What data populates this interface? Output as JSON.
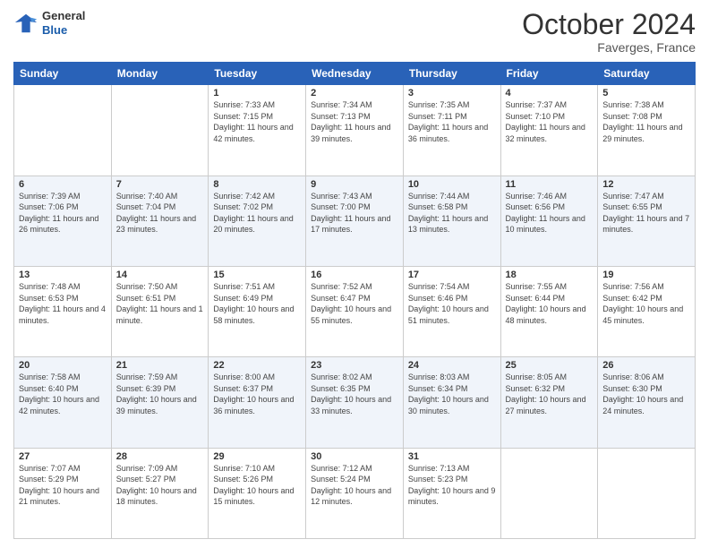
{
  "header": {
    "logo_line1": "General",
    "logo_line2": "Blue",
    "month": "October 2024",
    "location": "Faverges, France"
  },
  "weekdays": [
    "Sunday",
    "Monday",
    "Tuesday",
    "Wednesday",
    "Thursday",
    "Friday",
    "Saturday"
  ],
  "weeks": [
    [
      {
        "day": null,
        "info": null
      },
      {
        "day": null,
        "info": null
      },
      {
        "day": "1",
        "info": "Sunrise: 7:33 AM\nSunset: 7:15 PM\nDaylight: 11 hours and 42 minutes."
      },
      {
        "day": "2",
        "info": "Sunrise: 7:34 AM\nSunset: 7:13 PM\nDaylight: 11 hours and 39 minutes."
      },
      {
        "day": "3",
        "info": "Sunrise: 7:35 AM\nSunset: 7:11 PM\nDaylight: 11 hours and 36 minutes."
      },
      {
        "day": "4",
        "info": "Sunrise: 7:37 AM\nSunset: 7:10 PM\nDaylight: 11 hours and 32 minutes."
      },
      {
        "day": "5",
        "info": "Sunrise: 7:38 AM\nSunset: 7:08 PM\nDaylight: 11 hours and 29 minutes."
      }
    ],
    [
      {
        "day": "6",
        "info": "Sunrise: 7:39 AM\nSunset: 7:06 PM\nDaylight: 11 hours and 26 minutes."
      },
      {
        "day": "7",
        "info": "Sunrise: 7:40 AM\nSunset: 7:04 PM\nDaylight: 11 hours and 23 minutes."
      },
      {
        "day": "8",
        "info": "Sunrise: 7:42 AM\nSunset: 7:02 PM\nDaylight: 11 hours and 20 minutes."
      },
      {
        "day": "9",
        "info": "Sunrise: 7:43 AM\nSunset: 7:00 PM\nDaylight: 11 hours and 17 minutes."
      },
      {
        "day": "10",
        "info": "Sunrise: 7:44 AM\nSunset: 6:58 PM\nDaylight: 11 hours and 13 minutes."
      },
      {
        "day": "11",
        "info": "Sunrise: 7:46 AM\nSunset: 6:56 PM\nDaylight: 11 hours and 10 minutes."
      },
      {
        "day": "12",
        "info": "Sunrise: 7:47 AM\nSunset: 6:55 PM\nDaylight: 11 hours and 7 minutes."
      }
    ],
    [
      {
        "day": "13",
        "info": "Sunrise: 7:48 AM\nSunset: 6:53 PM\nDaylight: 11 hours and 4 minutes."
      },
      {
        "day": "14",
        "info": "Sunrise: 7:50 AM\nSunset: 6:51 PM\nDaylight: 11 hours and 1 minute."
      },
      {
        "day": "15",
        "info": "Sunrise: 7:51 AM\nSunset: 6:49 PM\nDaylight: 10 hours and 58 minutes."
      },
      {
        "day": "16",
        "info": "Sunrise: 7:52 AM\nSunset: 6:47 PM\nDaylight: 10 hours and 55 minutes."
      },
      {
        "day": "17",
        "info": "Sunrise: 7:54 AM\nSunset: 6:46 PM\nDaylight: 10 hours and 51 minutes."
      },
      {
        "day": "18",
        "info": "Sunrise: 7:55 AM\nSunset: 6:44 PM\nDaylight: 10 hours and 48 minutes."
      },
      {
        "day": "19",
        "info": "Sunrise: 7:56 AM\nSunset: 6:42 PM\nDaylight: 10 hours and 45 minutes."
      }
    ],
    [
      {
        "day": "20",
        "info": "Sunrise: 7:58 AM\nSunset: 6:40 PM\nDaylight: 10 hours and 42 minutes."
      },
      {
        "day": "21",
        "info": "Sunrise: 7:59 AM\nSunset: 6:39 PM\nDaylight: 10 hours and 39 minutes."
      },
      {
        "day": "22",
        "info": "Sunrise: 8:00 AM\nSunset: 6:37 PM\nDaylight: 10 hours and 36 minutes."
      },
      {
        "day": "23",
        "info": "Sunrise: 8:02 AM\nSunset: 6:35 PM\nDaylight: 10 hours and 33 minutes."
      },
      {
        "day": "24",
        "info": "Sunrise: 8:03 AM\nSunset: 6:34 PM\nDaylight: 10 hours and 30 minutes."
      },
      {
        "day": "25",
        "info": "Sunrise: 8:05 AM\nSunset: 6:32 PM\nDaylight: 10 hours and 27 minutes."
      },
      {
        "day": "26",
        "info": "Sunrise: 8:06 AM\nSunset: 6:30 PM\nDaylight: 10 hours and 24 minutes."
      }
    ],
    [
      {
        "day": "27",
        "info": "Sunrise: 7:07 AM\nSunset: 5:29 PM\nDaylight: 10 hours and 21 minutes."
      },
      {
        "day": "28",
        "info": "Sunrise: 7:09 AM\nSunset: 5:27 PM\nDaylight: 10 hours and 18 minutes."
      },
      {
        "day": "29",
        "info": "Sunrise: 7:10 AM\nSunset: 5:26 PM\nDaylight: 10 hours and 15 minutes."
      },
      {
        "day": "30",
        "info": "Sunrise: 7:12 AM\nSunset: 5:24 PM\nDaylight: 10 hours and 12 minutes."
      },
      {
        "day": "31",
        "info": "Sunrise: 7:13 AM\nSunset: 5:23 PM\nDaylight: 10 hours and 9 minutes."
      },
      {
        "day": null,
        "info": null
      },
      {
        "day": null,
        "info": null
      }
    ]
  ]
}
